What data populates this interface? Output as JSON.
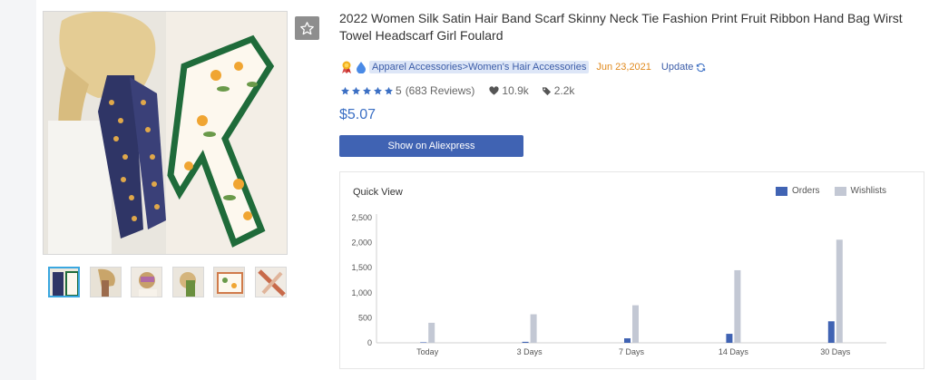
{
  "product": {
    "title": "2022 Women Silk Satin Hair Band Scarf Skinny Neck Tie Fashion Print Fruit Ribbon Hand Bag Wirst Towel Headscarf Girl Foulard",
    "category": "Apparel Accessories>Women's Hair Accessories",
    "date": "Jun 23,2021",
    "update_label": "Update",
    "rating": "5",
    "reviews": "(683 Reviews)",
    "likes": "10.9k",
    "tags": "2.2k",
    "price": "$5.07",
    "button_label": "Show on Aliexpress"
  },
  "colors": {
    "orders": "#4063b3",
    "wishlists": "#c3c8d4",
    "accent": "#4063b3"
  },
  "quick_view": {
    "title": "Quick View",
    "legend": {
      "orders": "Orders",
      "wishlists": "Wishlists"
    }
  },
  "chart_data": {
    "type": "bar",
    "categories": [
      "Today",
      "3 Days",
      "7 Days",
      "14 Days",
      "30 Days"
    ],
    "series": [
      {
        "name": "Orders",
        "values": [
          10,
          20,
          90,
          180,
          430
        ]
      },
      {
        "name": "Wishlists",
        "values": [
          400,
          570,
          750,
          1450,
          2060
        ]
      }
    ],
    "yticks": [
      "2,500",
      "2,000",
      "1,500",
      "1,000",
      "500",
      "0"
    ],
    "ylim": [
      0,
      2500
    ],
    "legend_position": "top-right"
  },
  "icons": {
    "favorite": "star-outline-icon",
    "badge": "medal-icon",
    "drop": "water-drop-icon",
    "refresh": "refresh-icon",
    "heart": "heart-icon",
    "tag": "tag-icon"
  }
}
